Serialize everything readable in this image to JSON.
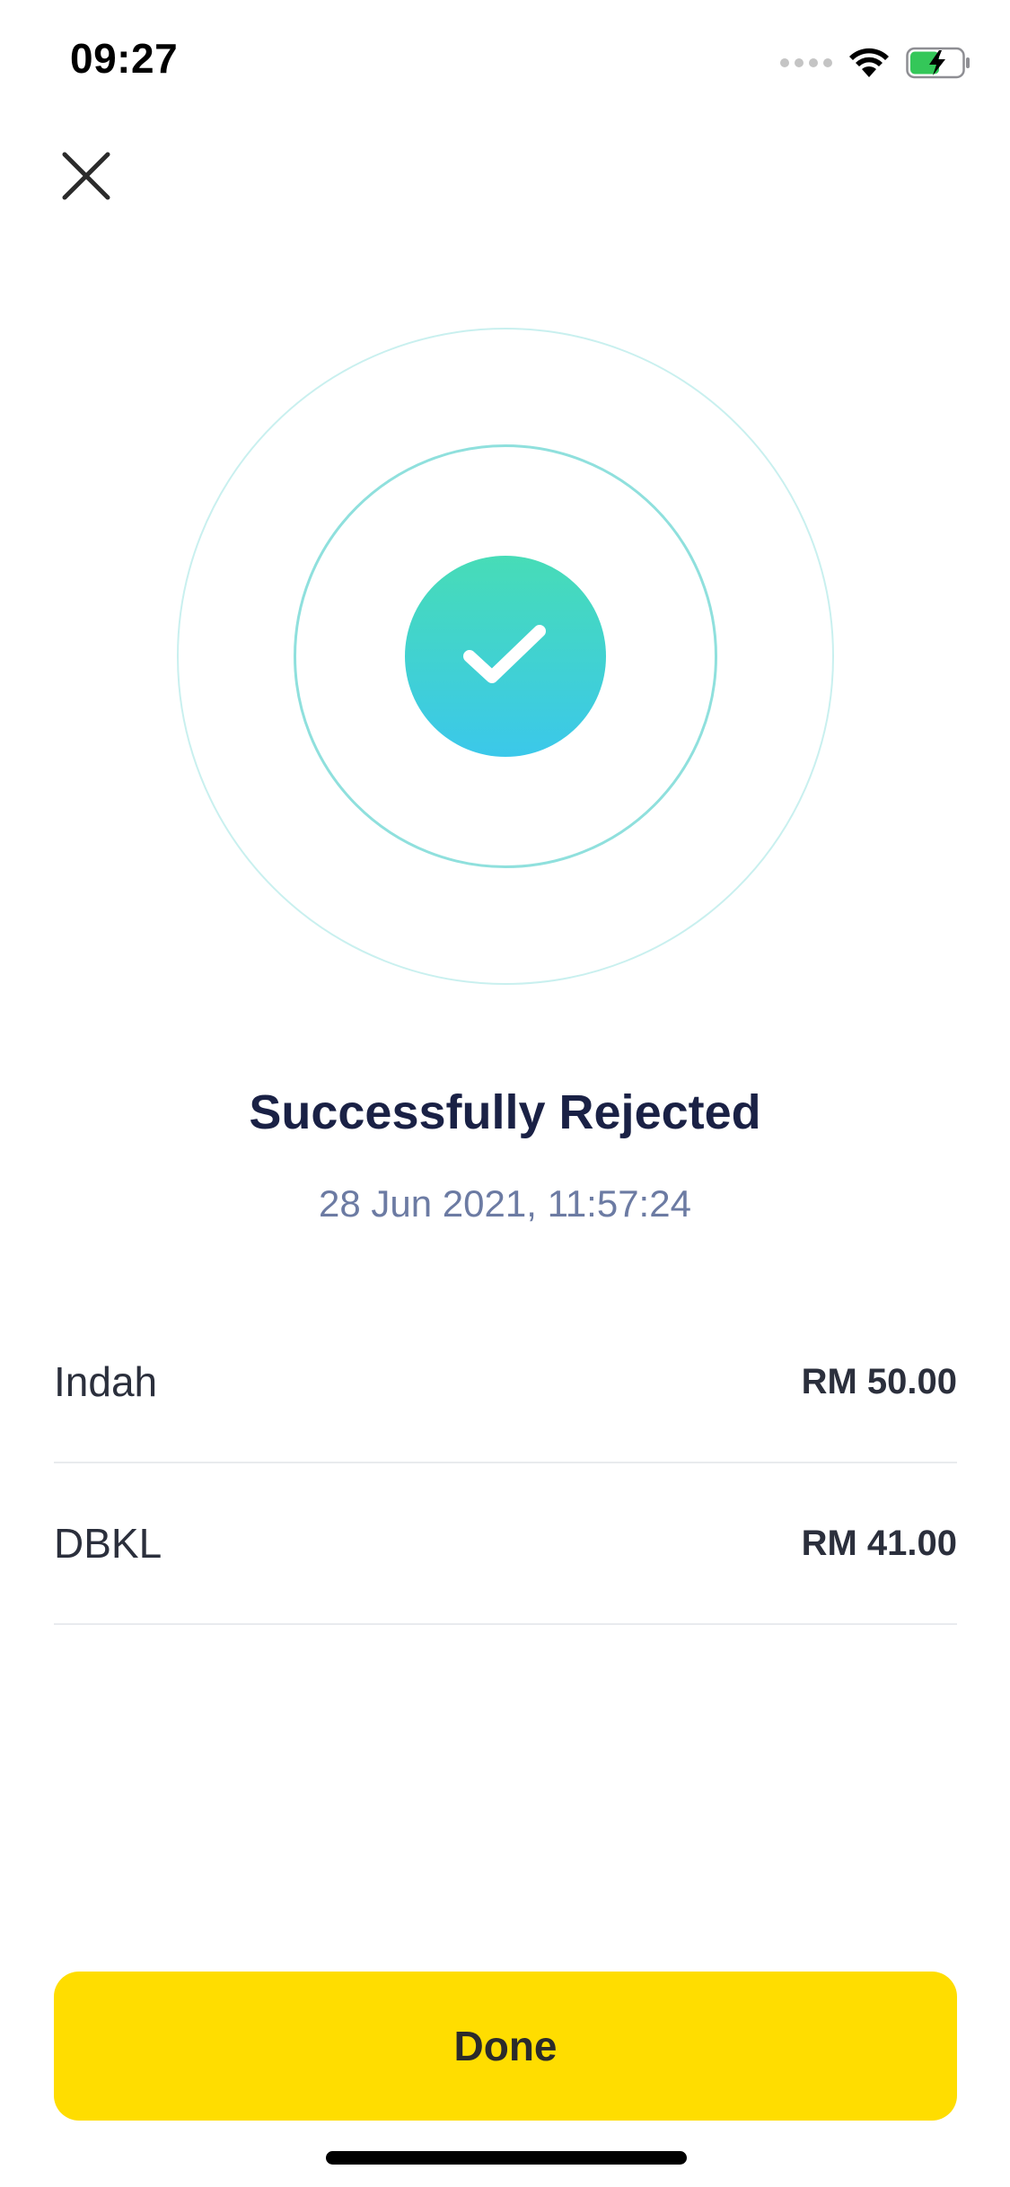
{
  "status_bar": {
    "time": "09:27",
    "icons": [
      "cellular-signal-icon",
      "wifi-icon",
      "battery-charging-icon"
    ]
  },
  "header": {
    "close_icon": "close-icon"
  },
  "result": {
    "icon": "checkmark-icon",
    "title": "Successfully Rejected",
    "timestamp": "28 Jun 2021, 11:57:24"
  },
  "items": [
    {
      "name": "Indah",
      "amount": "RM 50.00"
    },
    {
      "name": "DBKL",
      "amount": "RM 41.00"
    }
  ],
  "actions": {
    "done_label": "Done"
  },
  "colors": {
    "accent_yellow": "#ffdd00",
    "success_gradient_top": "#47dcb7",
    "success_gradient_bottom": "#3bc8ea",
    "title_text": "#1a2145",
    "timestamp_text": "#6c7ba3",
    "battery_fill": "#34c759"
  }
}
